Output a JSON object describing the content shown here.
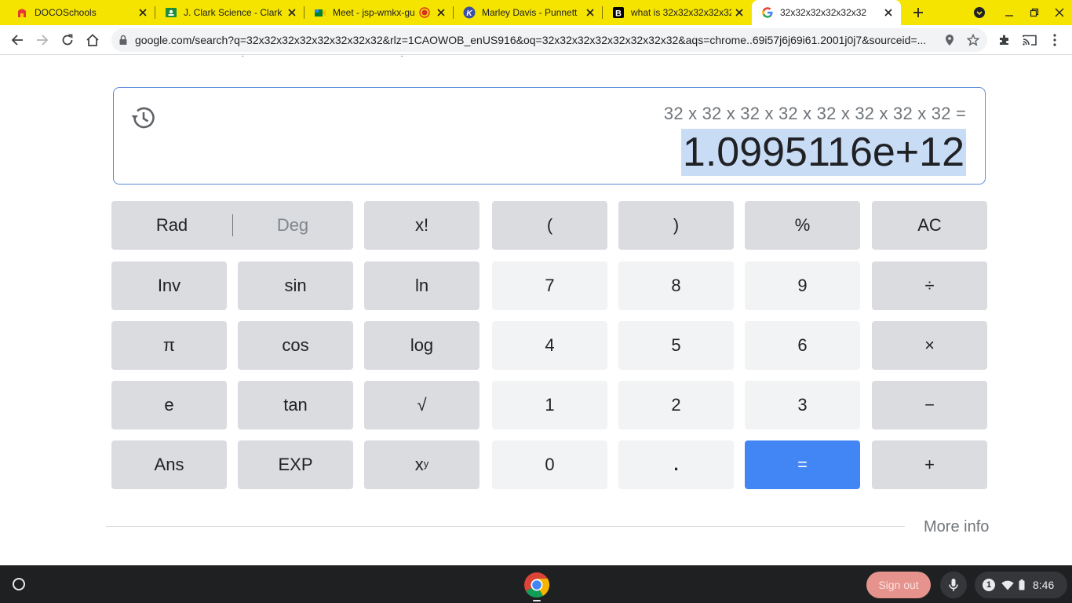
{
  "browser": {
    "tabs": [
      {
        "title": "DOCOSchools",
        "icon": "docoschools-favicon-icon",
        "active": false
      },
      {
        "title": "J. Clark Science - Clark",
        "icon": "classroom-favicon-icon",
        "active": false
      },
      {
        "title": "Meet - jsp-wmkx-gu",
        "icon": "meet-favicon-icon",
        "active": false
      },
      {
        "title": "Marley Davis - Punnett",
        "icon": "kami-favicon-icon",
        "active": false
      },
      {
        "title": "what is 32x32x32x32x32",
        "icon": "bold-b-favicon-icon",
        "active": false
      },
      {
        "title": "32x32x32x32x32x32",
        "icon": "google-favicon-icon",
        "active": true
      }
    ],
    "address_bar": {
      "url": "google.com/search?q=32x32x32x32x32x32x32x32&rlz=1CAOWOB_enUS916&oq=32x32x32x32x32x32x32x32&aqs=chrome..69i57j6j69i61.2001j0j7&sourceid=..."
    },
    "tabstrip_color": "#f5e400"
  },
  "calculator": {
    "expression": "32 x 32 x 32 x 32 x 32 x 32 x 32 x 32 =",
    "result": "1.0995116e+12",
    "keys": {
      "rad": "Rad",
      "deg": "Deg",
      "fact": "x!",
      "lparen": "(",
      "rparen": ")",
      "percent": "%",
      "ac": "AC",
      "inv": "Inv",
      "sin": "sin",
      "ln": "ln",
      "seven": "7",
      "eight": "8",
      "nine": "9",
      "divide": "÷",
      "pi": "π",
      "cos": "cos",
      "log": "log",
      "four": "4",
      "five": "5",
      "six": "6",
      "multiply": "×",
      "e": "e",
      "tan": "tan",
      "sqrt": "√",
      "one": "1",
      "two": "2",
      "three": "3",
      "minus": "−",
      "ans": "Ans",
      "exp": "EXP",
      "pow_base": "x",
      "pow_exp": "y",
      "zero": "0",
      "dot": ".",
      "equals": "=",
      "plus": "+"
    },
    "more_info": "More info",
    "accent_color": "#4285f4"
  },
  "shelf": {
    "sign_out": "Sign out",
    "notification_count": "1",
    "time": "8:46"
  }
}
